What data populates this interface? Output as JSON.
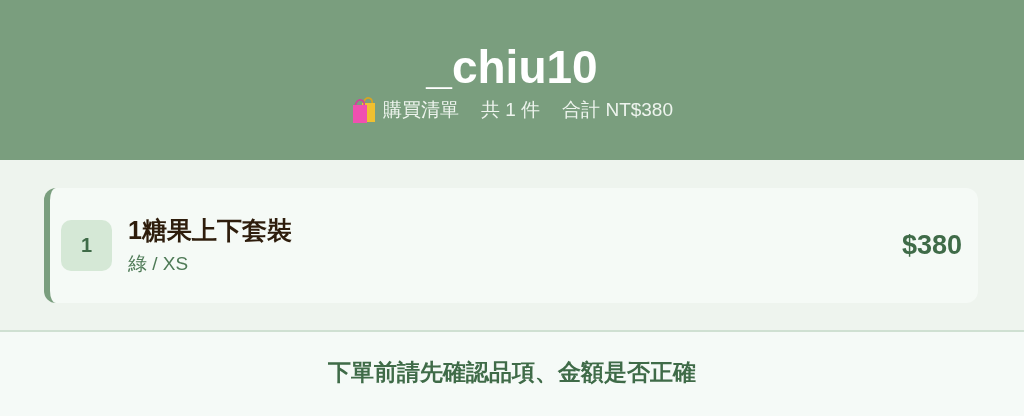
{
  "header": {
    "title": "_chiu10",
    "list_label": "購買清單",
    "count": "共 1 件",
    "total": "合計 NT$380"
  },
  "items": [
    {
      "index": "1",
      "name": "1糖果上下套裝",
      "variant": "綠 / XS",
      "price": "$380"
    }
  ],
  "footer": {
    "note": "下單前請先確認品項、金額是否正確"
  }
}
